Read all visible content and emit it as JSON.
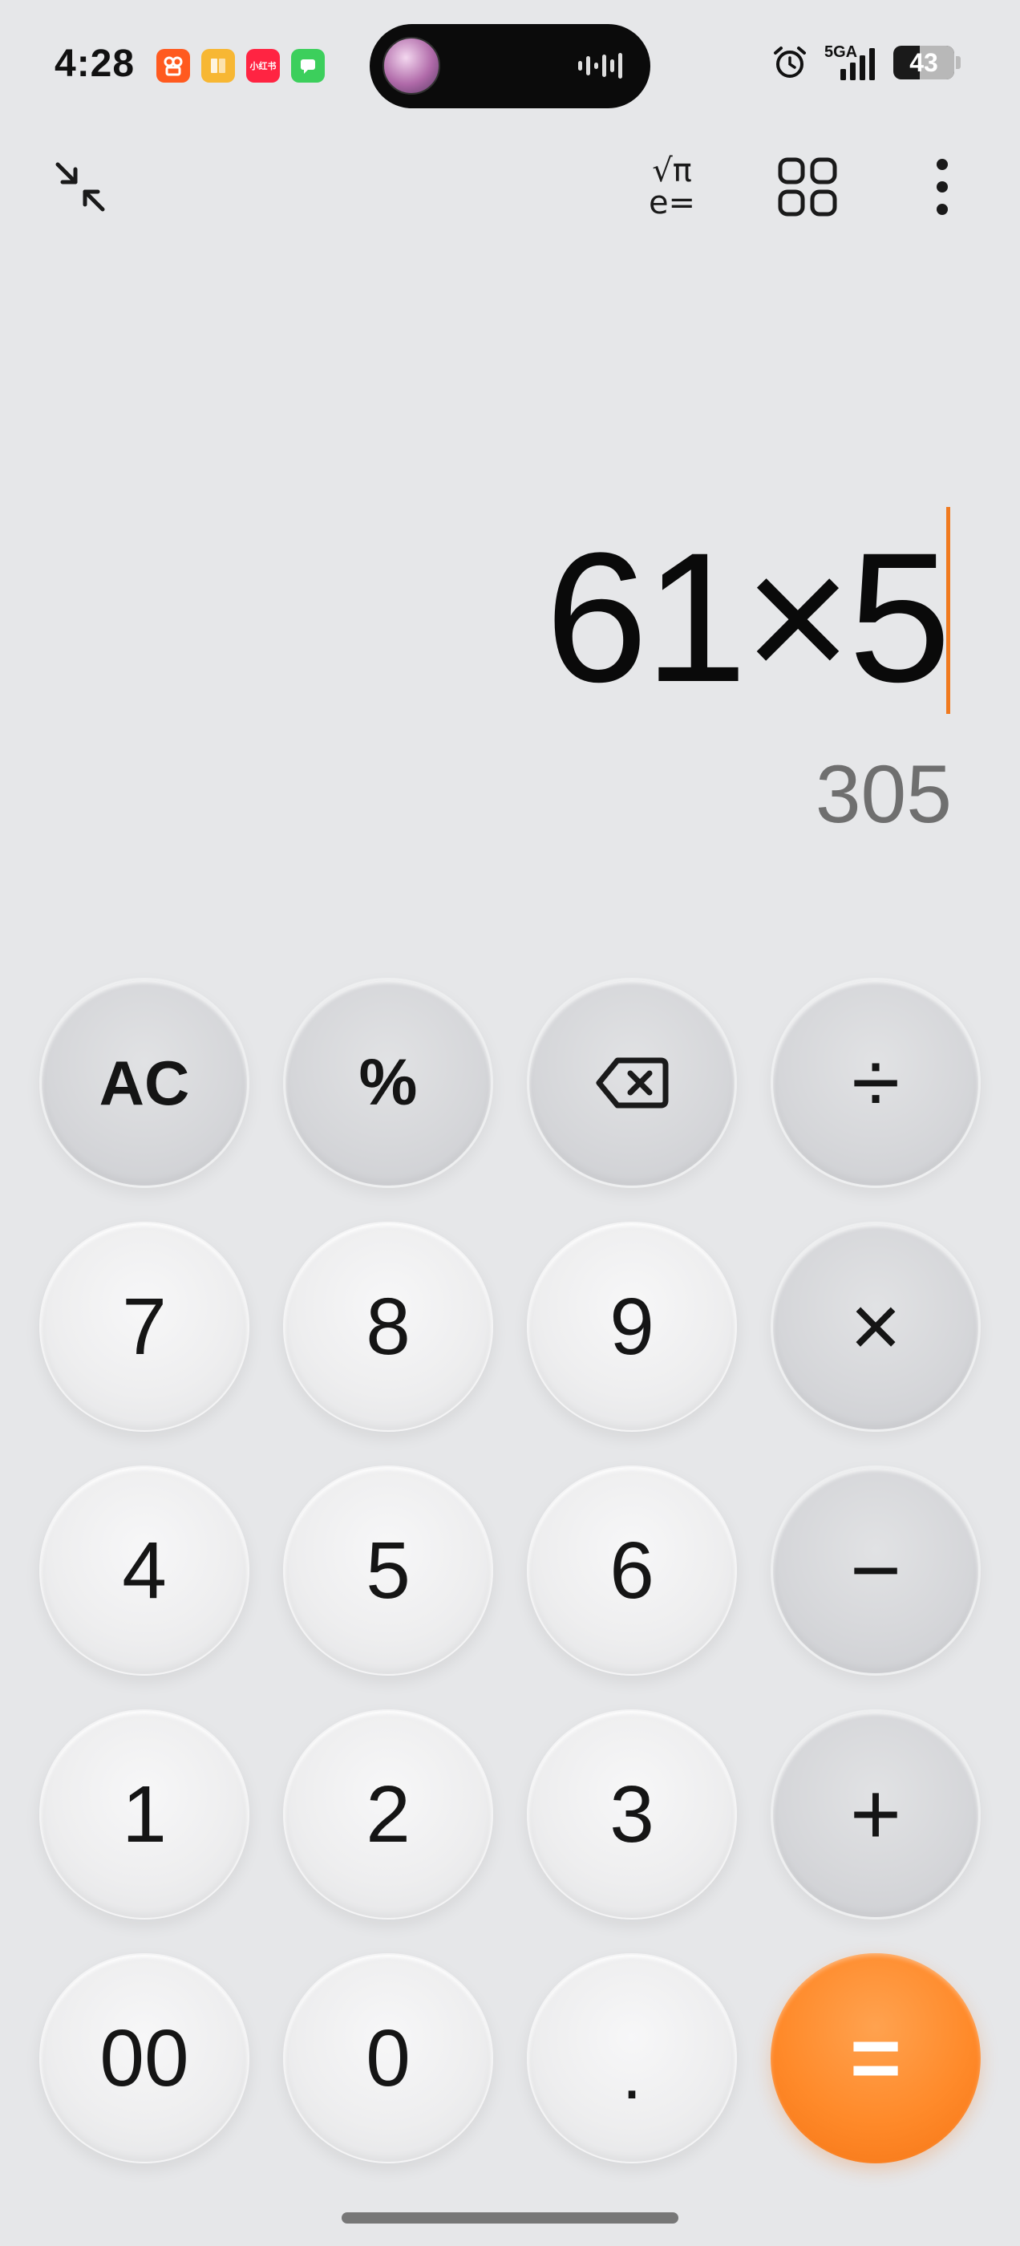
{
  "status_bar": {
    "time": "4:28",
    "notifications": [
      {
        "name": "app-notification-icon-1",
        "color": "#ff5a1f",
        "text": ""
      },
      {
        "name": "app-notification-icon-2",
        "color": "#f7b733",
        "text": ""
      },
      {
        "name": "app-notification-icon-3",
        "color": "#ff2442",
        "text": "小红书"
      },
      {
        "name": "app-notification-icon-4",
        "color": "#3ccf5c",
        "text": ""
      }
    ],
    "network": "5GA",
    "battery": "43",
    "battery_level": 0.43
  },
  "toolbar": {
    "minimize_icon": "minimize-arrows-icon",
    "scientific_icon": "scientific-mode-icon",
    "scientific_glyph_top": "√π",
    "scientific_glyph_bottom": "e=",
    "converter_icon": "grid-icon",
    "more_icon": "more-vertical-icon"
  },
  "display": {
    "expression": "61×5",
    "result": "305",
    "cursor_color": "#f07a1f"
  },
  "keypad": {
    "rows": [
      [
        {
          "label": "AC",
          "type": "op",
          "name": "all-clear-button"
        },
        {
          "label": "%",
          "type": "op",
          "name": "percent-button"
        },
        {
          "label": "",
          "type": "op",
          "name": "backspace-button",
          "icon": "backspace-icon"
        },
        {
          "label": "÷",
          "type": "op",
          "name": "divide-button"
        }
      ],
      [
        {
          "label": "7",
          "type": "digit",
          "name": "digit-7-button"
        },
        {
          "label": "8",
          "type": "digit",
          "name": "digit-8-button"
        },
        {
          "label": "9",
          "type": "digit",
          "name": "digit-9-button"
        },
        {
          "label": "×",
          "type": "op",
          "name": "multiply-button"
        }
      ],
      [
        {
          "label": "4",
          "type": "digit",
          "name": "digit-4-button"
        },
        {
          "label": "5",
          "type": "digit",
          "name": "digit-5-button"
        },
        {
          "label": "6",
          "type": "digit",
          "name": "digit-6-button"
        },
        {
          "label": "−",
          "type": "op",
          "name": "minus-button"
        }
      ],
      [
        {
          "label": "1",
          "type": "digit",
          "name": "digit-1-button"
        },
        {
          "label": "2",
          "type": "digit",
          "name": "digit-2-button"
        },
        {
          "label": "3",
          "type": "digit",
          "name": "digit-3-button"
        },
        {
          "label": "+",
          "type": "op",
          "name": "plus-button"
        }
      ],
      [
        {
          "label": "00",
          "type": "digit",
          "name": "double-zero-button"
        },
        {
          "label": "0",
          "type": "digit",
          "name": "digit-0-button"
        },
        {
          "label": ".",
          "type": "digit",
          "name": "decimal-button"
        },
        {
          "label": "=",
          "type": "equals",
          "name": "equals-button"
        }
      ]
    ],
    "equals_color": "#ff8a2a"
  }
}
